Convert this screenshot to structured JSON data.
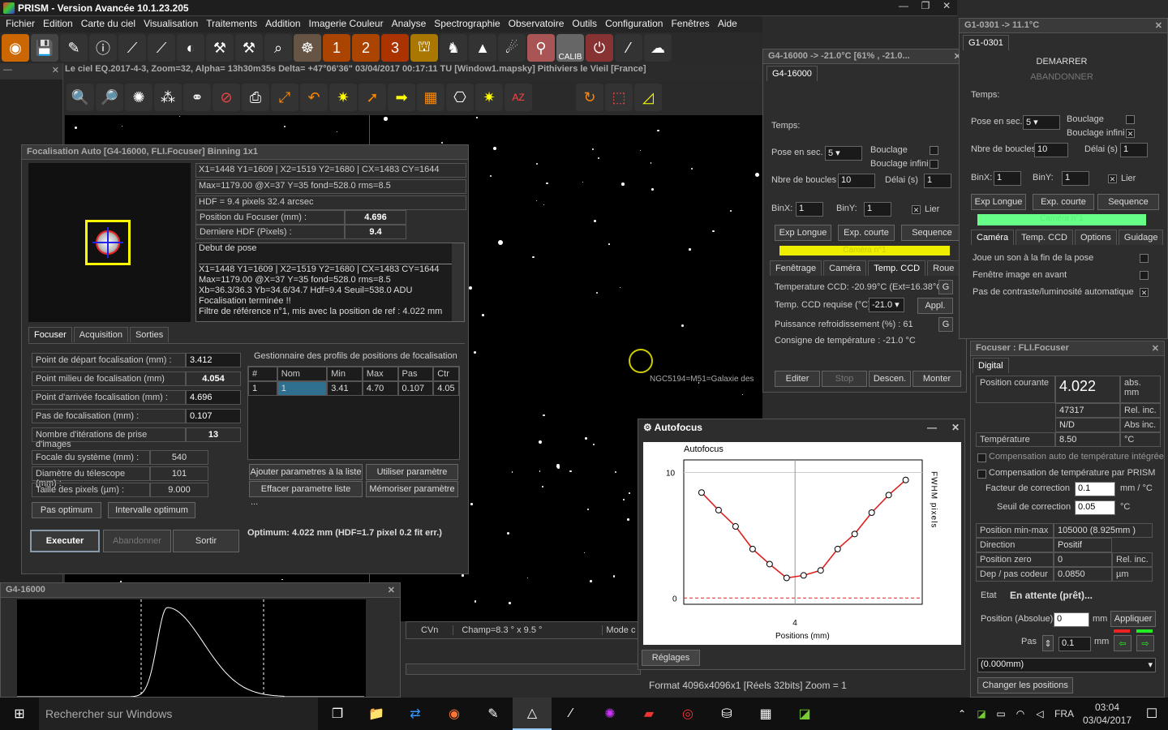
{
  "app": {
    "title": "PRISM - Version Avancée  10.1.23.205"
  },
  "menu": [
    "Fichier",
    "Edition",
    "Carte du ciel",
    "Visualisation",
    "Traitements",
    "Addition",
    "Imagerie Couleur",
    "Analyse",
    "Spectrographie",
    "Observatoire",
    "Outils",
    "Configuration",
    "Fenêtres",
    "Aide"
  ],
  "statusline": "Le ciel EQ.2017-4-3, Zoom=32, Alpha= 13h30m35s Delta= +47°06'36\"    03/04/2017 00:17:11 TU [Window1.mapsky]  Pithiviers le Vieil [France]",
  "calib_label": "CALIB",
  "focus": {
    "title": "Focalisation Auto [G4-16000, FLI.Focuser] Binning 1x1",
    "info1": "X1=1448 Y1=1609 | X2=1519 Y2=1680 | CX=1483  CY=1644",
    "info2": "Max=1179.00  @X=37 Y=35  fond=528.0  rms=8.5",
    "info3": "HDF = 9.4 pixels  32.4 arcsec",
    "pos_label": "Position du Focuser  (mm) :",
    "pos_val": "4.696",
    "hdf_label": "Derniere HDF  (Pixels) :",
    "hdf_val": "9.4",
    "log": [
      "Debut de pose",
      "",
      "X1=1448 Y1=1609 | X2=1519 Y2=1680 | CX=1483  CY=1644",
      "Max=1179.00  @X=37 Y=35  fond=528.0  rms=8.5",
      "Xb=36.3/36.3  Yb=34.6/34.7  Hdf=9.4  Seuil=538.0 ADU",
      "Focalisation terminée !!",
      "Filtre de référence n°1, mis avec la position de ref : 4.022 mm"
    ],
    "tabs": [
      "Focuser",
      "Acquisition",
      "Sorties"
    ],
    "params": [
      {
        "label": "Point de départ focalisation (mm) :",
        "value": "3.412"
      },
      {
        "label": "Point milieu de focalisation (mm)",
        "value": "4.054"
      },
      {
        "label": "Point d'arrivée focalisation (mm) :",
        "value": "4.696"
      },
      {
        "label": "Pas de focalisation (mm) :",
        "value": "0.107"
      },
      {
        "label": "Nombre d'itérations de prise d'images",
        "value": "13"
      }
    ],
    "optics": [
      {
        "label": "Focale du système (mm) :",
        "value": "540"
      },
      {
        "label": "Diamètre du télescope (mm) :",
        "value": "101"
      },
      {
        "label": "Taille des pixels (µm) :",
        "value": "9.000"
      }
    ],
    "pas_optimum": "Pas optimum",
    "intervalle_optimum": "Intervalle optimum",
    "profiles_title": "Gestionnaire des profils de positions de focalisation",
    "profiles_headers": [
      "#",
      "Nom",
      "Min",
      "Max",
      "Pas",
      "Ctr"
    ],
    "profiles_row": [
      "1",
      "1",
      "3.41",
      "4.70",
      "0.107",
      "4.05"
    ],
    "btn_add": "Ajouter parametres à la liste",
    "btn_use": "Utiliser paramètre",
    "btn_clear": "Effacer parametre liste",
    "btn_save": "Mémoriser paramètre",
    "ellipsis": "...",
    "btn_exec": "Executer",
    "btn_abort": "Abandonner",
    "btn_exit": "Sortir",
    "optimum": "Optimum: 4.022 mm (HDF=1.7 pixel 0.2 fit err.)"
  },
  "hist": {
    "title": "G4-16000"
  },
  "bottom": {
    "cvn": "CVn",
    "champ": "Champ=8.3 ° x 9.5 °",
    "mode": "Mode c",
    "format": "Format 4096x4096x1 [Réels 32bits]  Zoom = 1"
  },
  "sky": {
    "label": "NGC5194=M51=Galaxie des"
  },
  "autofocus": {
    "title": "Autofocus",
    "chart_title": "Autofocus",
    "reglages": "Réglages",
    "yaxis_label": "FWHM pixels",
    "xaxis_label": "Positions (mm)"
  },
  "chart_data": {
    "type": "scatter",
    "title": "Autofocus",
    "xlabel": "Positions (mm)",
    "ylabel": "FWHM pixels",
    "x": [
      3.412,
      3.519,
      3.626,
      3.733,
      3.84,
      3.947,
      4.054,
      4.161,
      4.268,
      4.375,
      4.482,
      4.589,
      4.696
    ],
    "y": [
      8.4,
      7.0,
      5.7,
      3.9,
      2.7,
      1.6,
      1.8,
      2.2,
      3.9,
      5.1,
      6.8,
      8.2,
      9.4
    ],
    "xlim": [
      3.3,
      4.8
    ],
    "ylim": [
      -0.5,
      11
    ],
    "yticks": [
      "0",
      "10"
    ],
    "xticks": [
      "4"
    ],
    "fit_color": "#d22",
    "point_color": "#000"
  },
  "g4": {
    "title": "G4-16000  -> -21.0°C [61% , -21.0...",
    "tab": "G4-16000",
    "temps": "Temps:",
    "pose_label": "Pose en sec.",
    "pose_val": "5",
    "bouclage": "Bouclage",
    "bouclage_inf": "Bouclage infini",
    "nbre_label": "Nbre de boucles",
    "nbre_val": "10",
    "delai_label": "Délai (s)",
    "delai_val": "1",
    "binx": "BinX:",
    "binx_val": "1",
    "biny": "BinY:",
    "biny_val": "1",
    "lier": "Lier",
    "exp_longue": "Exp Longue",
    "exp_courte": "Exp. courte",
    "sequence": "Sequence",
    "camera_n": "Caméra n°1",
    "tabs": [
      "Fenêtrage",
      "Caméra",
      "Temp. CCD",
      "Roue"
    ],
    "temp_ccd": "Temperature CCD: -20.99°C (Ext=16.38°C)",
    "temp_req_label": "Temp. CCD requise (°C)",
    "temp_req_val": "-21.0",
    "appl": "Appl.",
    "puissance": "Puissance refroidissement (%) : 61",
    "consigne": "Consigne de température : -21.0 °C",
    "g": "G",
    "editer": "Editer",
    "stop": "Stop",
    "descen": "Descen.",
    "monter": "Monter"
  },
  "g1": {
    "title": "G1-0301  -> 11.1°C",
    "tab": "G1-0301",
    "demarrer": "DEMARRER",
    "abandonner": "ABANDONNER",
    "temps": "Temps:",
    "pose_label": "Pose en sec.",
    "pose_val": "5",
    "bouclage": "Bouclage",
    "bouclage_inf": "Bouclage infini",
    "nbre_label": "Nbre de boucles",
    "nbre_val": "10",
    "delai_label": "Délai (s)",
    "delai_val": "1",
    "binx": "BinX:",
    "binx_val": "1",
    "biny": "BinY:",
    "biny_val": "1",
    "lier": "Lier",
    "exp_longue": "Exp Longue",
    "exp_courte": "Exp. courte",
    "sequence": "Sequence",
    "camera_n": "Caméra n°1",
    "tabs": [
      "Caméra",
      "Temp. CCD",
      "Options",
      "Guidage"
    ],
    "opt1": "Joue un son à la fin de la pose",
    "opt2": "Fenêtre image en avant",
    "opt3": "Pas de contraste/luminosité automatique"
  },
  "focuser": {
    "title": "Focuser : FLI.Focuser",
    "tab": "Digital",
    "pos_courante_label": "Position courante",
    "pos_courante": "4.022",
    "abs_mm": "abs. mm",
    "rel_val": "47317",
    "rel_inc": "Rel. inc.",
    "nd": "N/D",
    "abs_inc": "Abs inc.",
    "temp_label": "Température",
    "temp_val": "8.50",
    "temp_unit": "°C",
    "comp1": "Compensation auto de température intégrée",
    "comp2": "Compensation de température par PRISM",
    "facteur_label": "Facteur de correction",
    "facteur_val": "0.1",
    "facteur_unit": "mm / °C",
    "seuil_label": "Seuil de correction",
    "seuil_val": "0.05",
    "seuil_unit": "°C",
    "minmax_label": "Position min-max",
    "minmax_val": "105000 (8.925mm )",
    "dir_label": "Direction",
    "dir_val": "Positif",
    "zero_label": "Position zero",
    "zero_val": "0",
    "zero_unit": "Rel. inc.",
    "dep_label": "Dep / pas codeur",
    "dep_val": "0.0850",
    "dep_unit": "µm",
    "etat_label": "Etat",
    "etat_val": "En attente (prêt)...",
    "posabs_label": "Position (Absolue)",
    "posabs_val": "0",
    "posabs_unit": "mm",
    "appliquer": "Appliquer",
    "pas_label": "Pas",
    "pas_val": "0.1",
    "pas_unit": "mm",
    "combo": "(0.000mm)",
    "changer": "Changer les positions"
  },
  "taskbar": {
    "search": "Rechercher sur Windows",
    "lang": "FRA",
    "time": "03:04",
    "date": "03/04/2017"
  }
}
